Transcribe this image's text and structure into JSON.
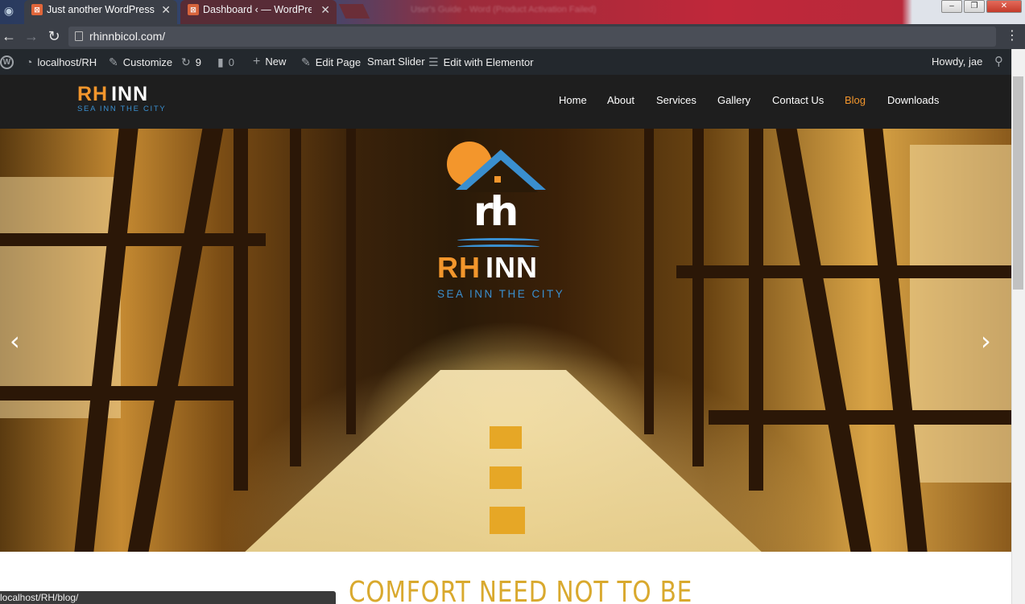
{
  "browser": {
    "tabs": [
      {
        "title": "Just another WordPress s",
        "active": true
      },
      {
        "title": "Dashboard ‹ — WordPres",
        "active": false
      }
    ],
    "blurred_tab": "User's Guide - Word (Product Activation Failed)",
    "url": "rhinnbicol.com/",
    "status_url": "localhost/RH/blog/"
  },
  "adminbar": {
    "site": "localhost/RH",
    "customize": "Customize",
    "updates": "9",
    "comments": "0",
    "new": "New",
    "edit_page": "Edit Page",
    "smart_slider": "Smart Slider",
    "elementor": "Edit with Elementor",
    "howdy": "Howdy, jae"
  },
  "site": {
    "logo_rh": "RH",
    "logo_inn": "INN",
    "tagline": "SEA INN THE CITY",
    "nav": [
      "Home",
      "About",
      "Services",
      "Gallery",
      "Contact Us",
      "Blog",
      "Downloads"
    ],
    "current_nav": "Blog"
  },
  "hero": {
    "brand_rh": "RH",
    "brand_inn": "INN",
    "tagline": "SEA INN THE CITY"
  },
  "content": {
    "heading": "COMFORT NEED NOT TO BE"
  },
  "colors": {
    "accent_orange": "#f3962c",
    "accent_blue": "#3a8fcf",
    "heading_gold": "#d9a92e",
    "admin_bar": "#23282d"
  }
}
